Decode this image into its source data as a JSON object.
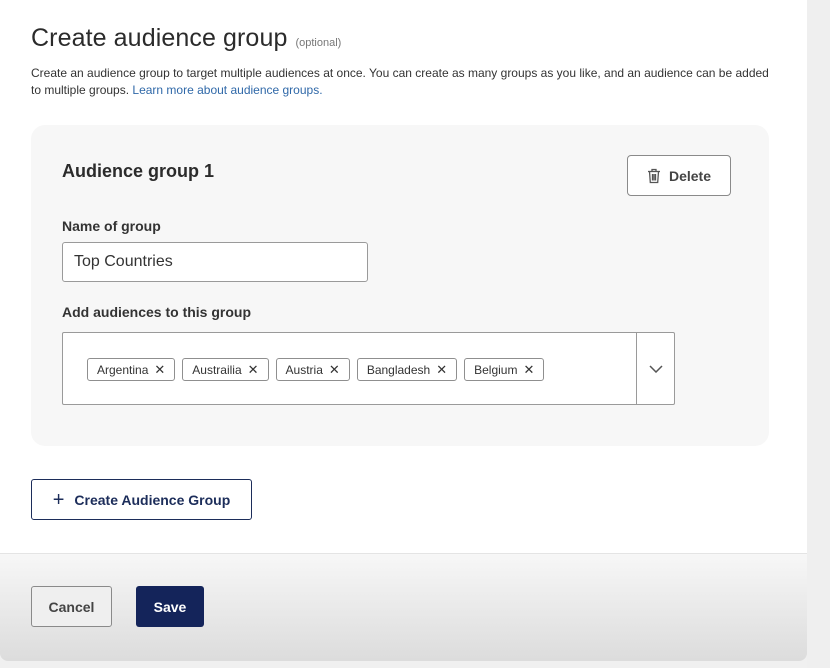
{
  "section": {
    "title": "Create audience group",
    "optional_tag": "(optional)",
    "description": "Create an audience group to target multiple audiences at once. You can create as many groups as you like, and an audience can be added to multiple groups.",
    "learn_more_link": "Learn more about audience groups."
  },
  "group": {
    "title": "Audience group 1",
    "delete_label": "Delete",
    "name_label": "Name of group",
    "name_value": "Top Countries",
    "audiences_label": "Add audiences to this group",
    "audiences": [
      {
        "label": "Argentina"
      },
      {
        "label": "Austrailia"
      },
      {
        "label": "Austria"
      },
      {
        "label": "Bangladesh"
      },
      {
        "label": "Belgium"
      }
    ],
    "remove_glyph": "✕"
  },
  "actions": {
    "create_group_label": "Create Audience Group",
    "create_group_icon": "plus-icon",
    "cancel_label": "Cancel",
    "save_label": "Save"
  },
  "colors": {
    "primary_navy": "#14245a",
    "link_blue": "#2f68a8",
    "card_bg": "#f7f7f7"
  }
}
